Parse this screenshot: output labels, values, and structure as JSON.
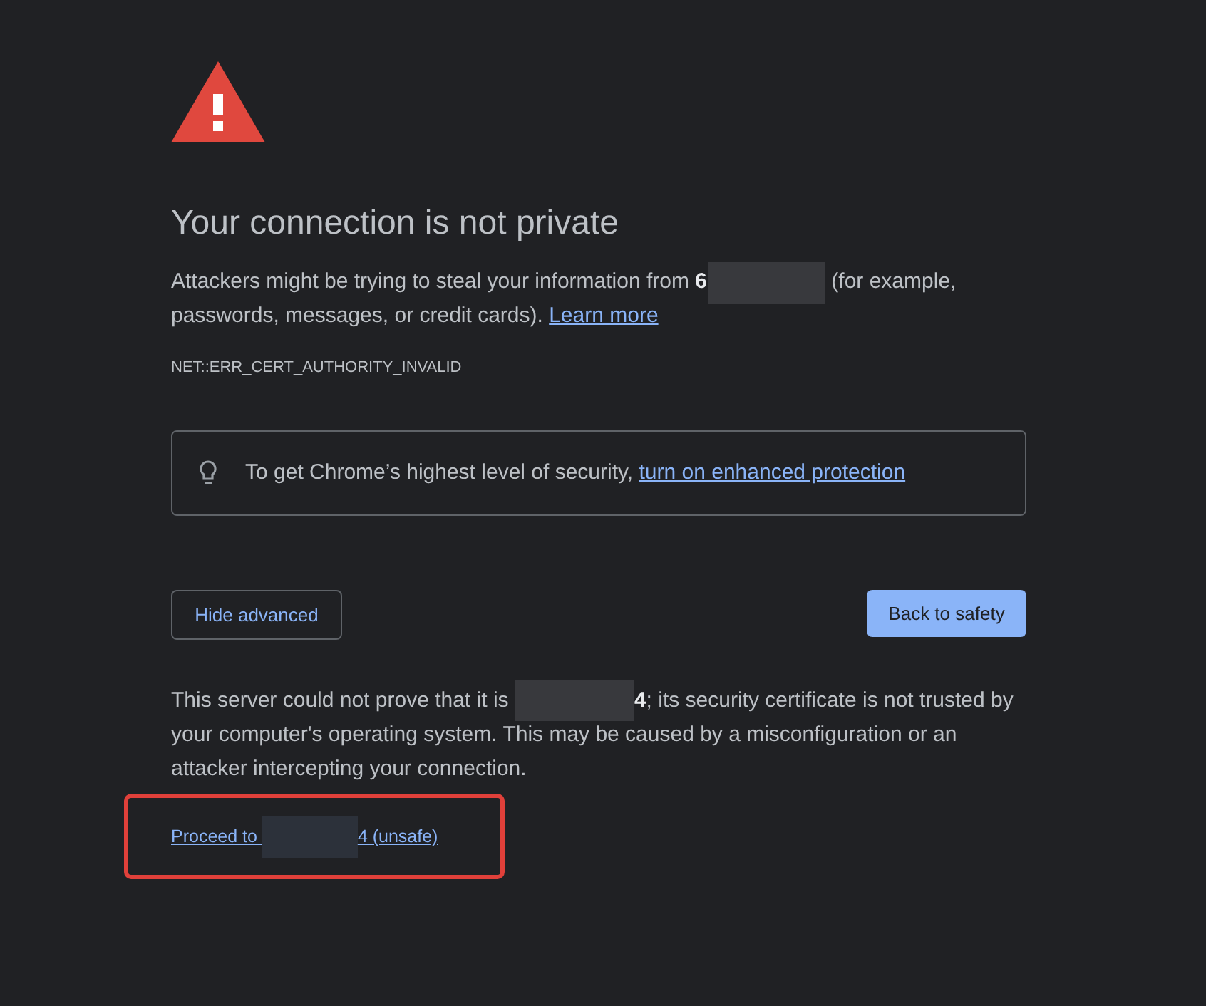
{
  "title": "Your connection is not private",
  "intro": [
    {
      "kind": "text",
      "text": "Attackers might be trying to steal your information from **6**"
    },
    {
      "kind": "redaction"
    },
    {
      "kind": "text",
      "text": " (for example, passwords, messages, or credit cards). "
    },
    {
      "kind": "link",
      "text": "Learn more"
    }
  ],
  "error_code": "NET::ERR_CERT_AUTHORITY_INVALID",
  "enhanced_protection": {
    "text": "To get Chrome’s highest level of security, ",
    "link": "turn on enhanced protection"
  },
  "buttons": [
    {
      "label": "Hide advanced",
      "kind": "secondary"
    },
    {
      "label": "Back to safety",
      "kind": "primary"
    }
  ],
  "details": [
    {
      "kind": "text",
      "text": "This server could not prove that it is "
    },
    {
      "kind": "redaction"
    },
    {
      "kind": "text",
      "text": "**4**; its security certificate is not trusted by your computer's operating system. This may be caused by a misconfiguration or an attacker intercepting your connection."
    }
  ],
  "proceed_link": {
    "parts": [
      {
        "kind": "text",
        "text": "Proceed to "
      },
      {
        "kind": "redaction"
      },
      {
        "kind": "text",
        "text": "4 (unsafe)"
      }
    ],
    "highlighted": true
  }
}
